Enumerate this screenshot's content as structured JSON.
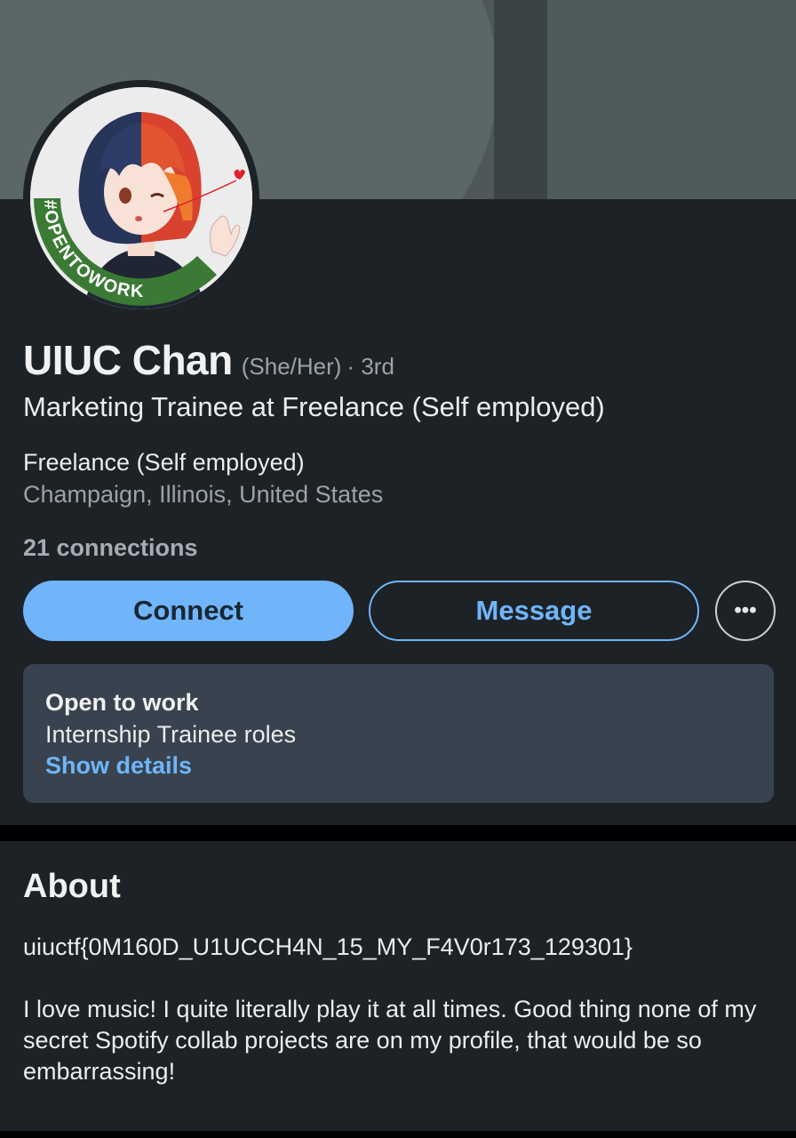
{
  "profile": {
    "name": "UIUC Chan",
    "pronouns": "(She/Her)",
    "degree": "· 3rd",
    "headline": "Marketing Trainee at Freelance (Self employed)",
    "company": "Freelance (Self employed)",
    "location": "Champaign, Illinois, United States",
    "connections": "21 connections",
    "avatar_badge": "#OPENTOWORK"
  },
  "actions": {
    "connect_label": "Connect",
    "message_label": "Message",
    "more_label": "•••"
  },
  "open_to_work": {
    "title": "Open to work",
    "roles": "Internship Trainee roles",
    "link": "Show details"
  },
  "about": {
    "title": "About",
    "flag": "uiuctf{0M160D_U1UCCH4N_15_MY_F4V0r173_129301}",
    "text": "I love music! I quite literally play it at all times. Good thing none of my secret Spotify collab projects are on my profile, that would be so embarrassing!"
  },
  "colors": {
    "accent": "#70b5f9",
    "open_to_work_green": "#3c7a3a",
    "background": "#1d2226"
  }
}
